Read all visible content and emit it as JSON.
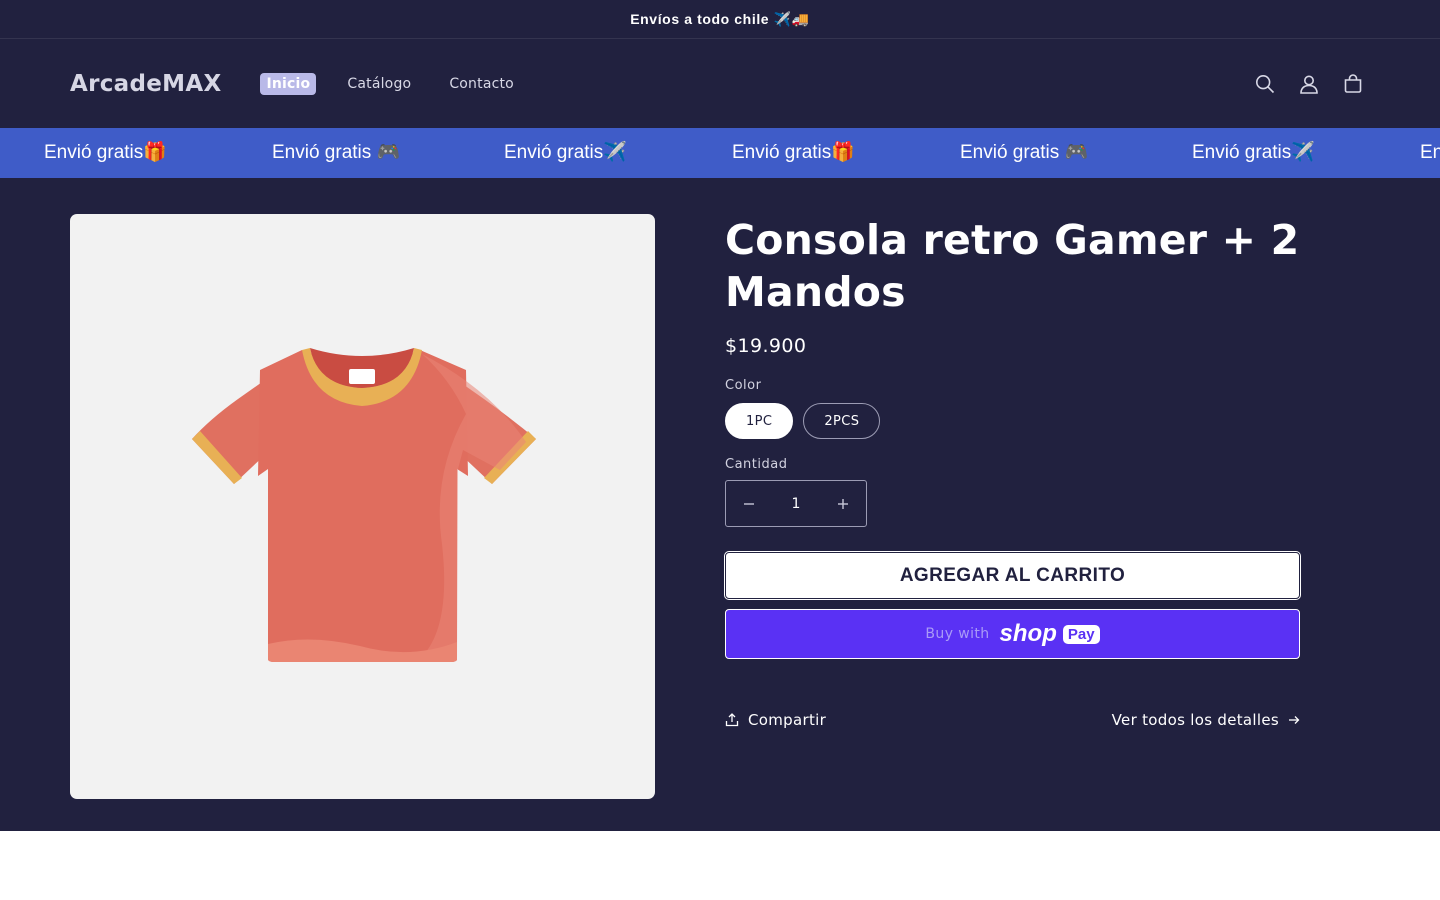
{
  "announcement": {
    "text": "Envíos a todo chile ✈️🚚"
  },
  "header": {
    "logo": "ArcadeMAX",
    "nav": [
      {
        "label": "Inicio",
        "active": true
      },
      {
        "label": "Catálogo",
        "active": false
      },
      {
        "label": "Contacto",
        "active": false
      }
    ],
    "icons": [
      "search-icon",
      "account-icon",
      "cart-icon"
    ]
  },
  "marquee": {
    "items": [
      "Envió gratis🎁",
      "Envió gratis 🎮",
      "Envió gratis✈️",
      "Envió gratis🎁",
      "Envió gratis 🎮",
      "Envió gratis✈️",
      "Envió gratis🎁"
    ]
  },
  "product": {
    "title": "Consola retro Gamer + 2 Mandos",
    "price": "$19.900",
    "color_label": "Color",
    "variants": [
      {
        "label": "1PC",
        "selected": true
      },
      {
        "label": "2PCS",
        "selected": false
      }
    ],
    "quantity_label": "Cantidad",
    "quantity": "1",
    "add_to_cart": "AGREGAR AL CARRITO",
    "buy_with": "Buy with",
    "shop_word": "shop",
    "pay_badge": "Pay",
    "share": "Compartir",
    "details": "Ver todos los detalles"
  },
  "colors": {
    "background": "#21213f",
    "marquee": "#3f5cc8",
    "shop_pay": "#5a31f4",
    "image_bg": "#f2f2f2"
  }
}
